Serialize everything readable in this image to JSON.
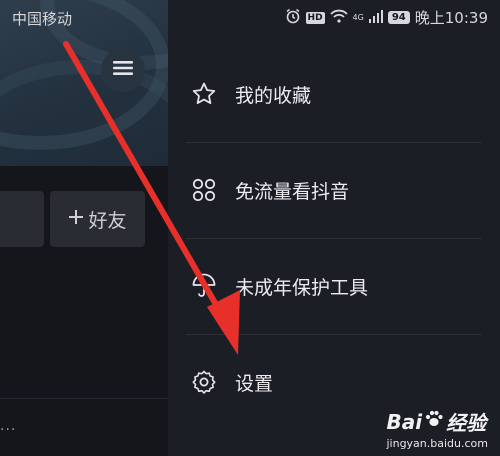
{
  "status_bar": {
    "carrier": "中国移动",
    "hd": "HD",
    "network": "4G",
    "battery": "94",
    "time": "晚上10:39"
  },
  "left_panel": {
    "add_friend_label": "好友",
    "add_friend_icon": "plus-icon",
    "more": "..."
  },
  "drawer": {
    "items": [
      {
        "label": "我的收藏",
        "icon": "star-icon"
      },
      {
        "label": "免流量看抖音",
        "icon": "grid-icon"
      },
      {
        "label": "未成年保护工具",
        "icon": "umbrella-icon"
      },
      {
        "label": "设置",
        "icon": "gear-icon"
      }
    ]
  },
  "watermark": {
    "logo_latin": "Bai",
    "logo_cn": "经验",
    "url": "jingyan.baidu.com"
  },
  "colors": {
    "arrow": "#e8302a",
    "drawer_bg": "#1c1e26",
    "cover": "#2a3846"
  }
}
